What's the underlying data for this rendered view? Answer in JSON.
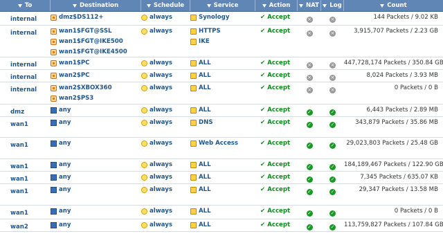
{
  "header": {
    "to": "To",
    "destination": "Destination",
    "schedule": "Schedule",
    "service": "Service",
    "action": "Action",
    "nat": "NAT",
    "log": "Log",
    "count": "Count"
  },
  "rows": [
    {
      "to": "internal",
      "destinations": [
        "dmz$DS112+"
      ],
      "dest_icon": "address-group-icon",
      "schedule": "always",
      "services": [
        "Synology"
      ],
      "action": "Accept",
      "nat": "off",
      "log": "off",
      "count": "144 Packets / 9.02 KB"
    },
    {
      "to": "internal",
      "destinations": [
        "wan1$FGT@SSL",
        "wan1$FGT@IKE500",
        "wan1$FGT@IKE4500"
      ],
      "dest_icon": "address-group-icon",
      "schedule": "always",
      "services": [
        "HTTPS",
        "IKE"
      ],
      "action": "Accept",
      "nat": "off",
      "log": "off",
      "count": "3,915,707 Packets / 2.23 GB"
    },
    {
      "to": "internal",
      "destinations": [
        "wan1$PC"
      ],
      "dest_icon": "address-group-icon",
      "schedule": "always",
      "services": [
        "ALL"
      ],
      "action": "Accept",
      "nat": "off",
      "log": "off",
      "count": "447,728,174 Packets / 350.84 GB"
    },
    {
      "to": "internal",
      "destinations": [
        "wan2$PC"
      ],
      "dest_icon": "address-group-icon",
      "schedule": "always",
      "services": [
        "ALL"
      ],
      "action": "Accept",
      "nat": "off",
      "log": "off",
      "count": "8,024 Packets / 3.93 MB"
    },
    {
      "to": "internal",
      "destinations": [
        "wan2$XBOX360",
        "wan2$PS3"
      ],
      "dest_icon": "address-group-icon",
      "schedule": "always",
      "services": [
        "ALL"
      ],
      "action": "Accept",
      "nat": "off",
      "log": "off",
      "count": "0 Packets / 0 B"
    },
    {
      "to": "dmz",
      "destinations": [
        "any"
      ],
      "dest_icon": "address-icon",
      "schedule": "always",
      "services": [
        "ALL"
      ],
      "action": "Accept",
      "nat": "on",
      "log": "on",
      "count": "6,443 Packets / 2.89 MB"
    },
    {
      "to": "wan1",
      "destinations": [
        "any"
      ],
      "dest_icon": "address-icon",
      "schedule": "always",
      "services": [
        "DNS"
      ],
      "action": "Accept",
      "nat": "on",
      "log": "on",
      "count": "343,879 Packets / 35.86 MB"
    },
    {
      "to": "wan1",
      "destinations": [
        "any"
      ],
      "dest_icon": "address-icon",
      "schedule": "always",
      "services": [
        "Web Access"
      ],
      "action": "Accept",
      "nat": "on",
      "log": "on",
      "count": "29,023,803 Packets / 25.48 GB"
    },
    {
      "to": "wan1",
      "destinations": [
        "any"
      ],
      "dest_icon": "address-icon",
      "schedule": "always",
      "services": [
        "ALL"
      ],
      "action": "Accept",
      "nat": "on",
      "log": "on",
      "count": "184,189,467 Packets / 122.90 GB"
    },
    {
      "to": "wan1",
      "destinations": [
        "any"
      ],
      "dest_icon": "address-icon",
      "schedule": "always",
      "services": [
        "ALL"
      ],
      "action": "Accept",
      "nat": "on",
      "log": "on",
      "count": "7,345 Packets / 635.07 KB"
    },
    {
      "to": "wan1",
      "destinations": [
        "any"
      ],
      "dest_icon": "address-icon",
      "schedule": "always",
      "services": [
        "ALL"
      ],
      "action": "Accept",
      "nat": "on",
      "log": "on",
      "count": "29,347 Packets / 13.58 MB"
    },
    {
      "to": "wan1",
      "destinations": [
        "any"
      ],
      "dest_icon": "address-icon",
      "schedule": "always",
      "services": [
        "ALL"
      ],
      "action": "Accept",
      "nat": "on",
      "log": "on",
      "count": "0 Packets / 0 B"
    },
    {
      "to": "wan2",
      "destinations": [
        "any"
      ],
      "dest_icon": "address-icon",
      "schedule": "always",
      "services": [
        "ALL"
      ],
      "action": "Accept",
      "nat": "on",
      "log": "on",
      "count": "113,759,827 Packets / 107.84 GB"
    }
  ],
  "colors": {
    "header_bg": "#5f86b5",
    "link": "#20558a",
    "accept": "#0f8a1c",
    "enabled": "#179a22",
    "disabled": "#9a9a9a"
  }
}
